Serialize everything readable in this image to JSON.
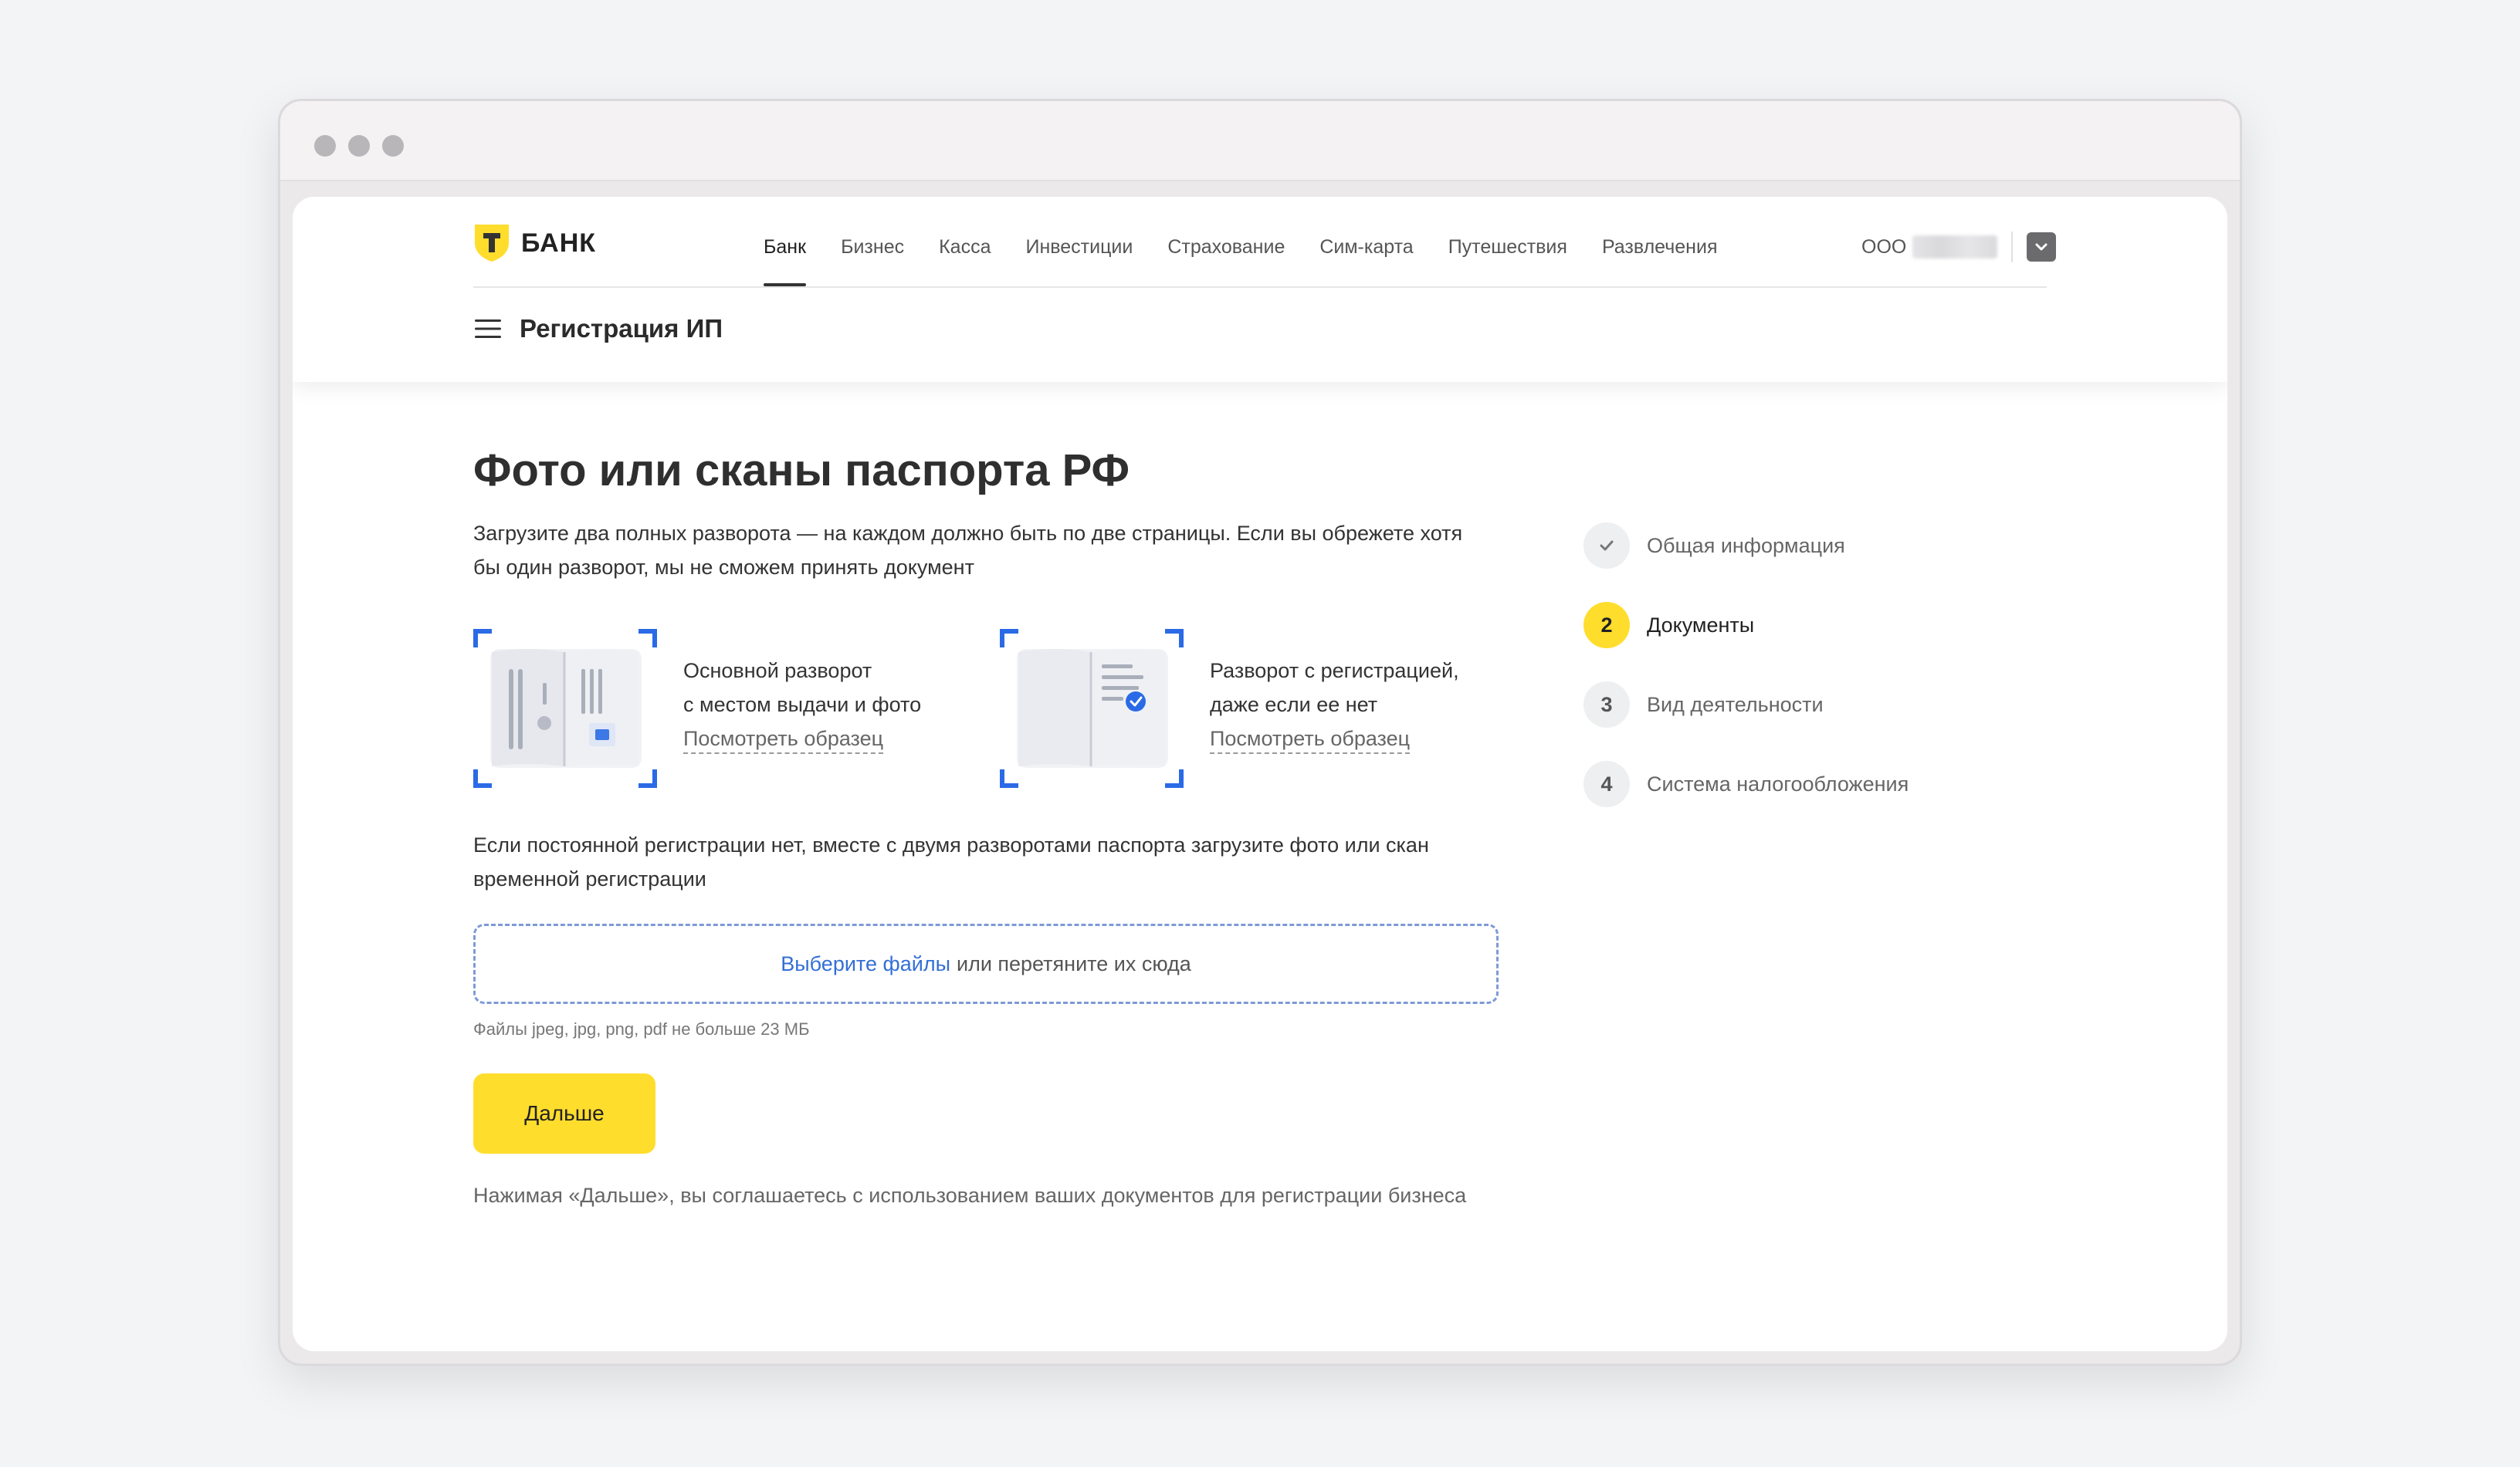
{
  "brand": {
    "name": "БАНК",
    "accent": "#ffdd2d",
    "link_color": "#336fd6"
  },
  "nav": {
    "items": [
      {
        "label": "Банк",
        "active": true
      },
      {
        "label": "Бизнес",
        "active": false
      },
      {
        "label": "Касса",
        "active": false
      },
      {
        "label": "Инвестиции",
        "active": false
      },
      {
        "label": "Страхование",
        "active": false
      },
      {
        "label": "Сим-карта",
        "active": false
      },
      {
        "label": "Путешествия",
        "active": false
      },
      {
        "label": "Развлечения",
        "active": false
      }
    ]
  },
  "account": {
    "label": "ООО"
  },
  "subheader": {
    "title": "Регистрация ИП"
  },
  "main": {
    "title": "Фото или сканы паспорта РФ",
    "lead": "Загрузите два полных разворота — на каждом должно быть по две страницы. Если вы обрежете хотя бы один разворот, мы не сможем принять документ",
    "spreads": [
      {
        "caption": "Основной разворот\nс местом выдачи и фото",
        "link": "Посмотреть образец",
        "icon": "passport-main-spread-icon"
      },
      {
        "caption": "Разворот с регистрацией,\nдаже если ее нет",
        "link": "Посмотреть образец",
        "icon": "passport-registration-spread-icon"
      }
    ],
    "note": "Если постоянной регистрации нет, вместе с двумя разворотами паспорта загрузите фото или скан временной регистрации",
    "dropzone": {
      "link": "Выберите файлы",
      "rest": "или перетяните их сюда"
    },
    "hint": "Файлы jpeg, jpg, png, pdf не больше 23 МБ",
    "next_label": "Дальше",
    "consent": "Нажимая «Дальше», вы соглашаетесь с использованием ваших документов для регистрации бизнеса"
  },
  "steps": [
    {
      "badge": "",
      "label": "Общая информация",
      "state": "done",
      "icon": "check-icon"
    },
    {
      "badge": "2",
      "label": "Документы",
      "state": "current"
    },
    {
      "badge": "3",
      "label": "Вид деятельности",
      "state": "pending"
    },
    {
      "badge": "4",
      "label": "Система налогообложения",
      "state": "pending"
    }
  ]
}
